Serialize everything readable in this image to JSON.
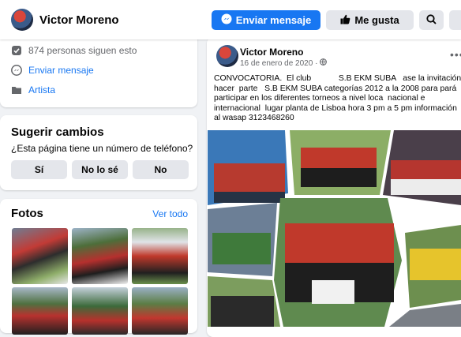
{
  "header": {
    "page_name": "Victor Moreno",
    "message_label": "Enviar mensaje",
    "like_label": "Me gusta"
  },
  "about": {
    "followers_text": "874 personas siguen esto",
    "send_message_link": "Enviar mensaje",
    "category_link": "Artista"
  },
  "suggest": {
    "title": "Sugerir cambios",
    "question": "¿Esta página tiene un número de teléfono?",
    "options": [
      "Sí",
      "No lo sé",
      "No"
    ]
  },
  "photos": {
    "title": "Fotos",
    "see_all": "Ver todo"
  },
  "post": {
    "author": "Victor Moreno",
    "date": "16 de enero de 2020 ·",
    "text": "CONVOCATORIA.  El club            S.B EKM SUBA   ase la invitación hacer  parte   S.B EKM SUBA categorías 2012 a la 2008 para pará participar en los diferentes torneos a nivel loca  nacional e internacional  lugar planta de Lisboa hora 3 pm a 5 pm información al wasap 3123468260"
  },
  "colors": {
    "brand_blue": "#1877f2",
    "page_background": "#f0f2f5",
    "button_grey": "#e4e6eb",
    "secondary_text": "#65676b"
  },
  "icons": [
    "messenger-icon",
    "thumbs-up-icon",
    "search-icon",
    "followers-icon",
    "globe-icon",
    "more-options-icon",
    "flag-icon"
  ]
}
